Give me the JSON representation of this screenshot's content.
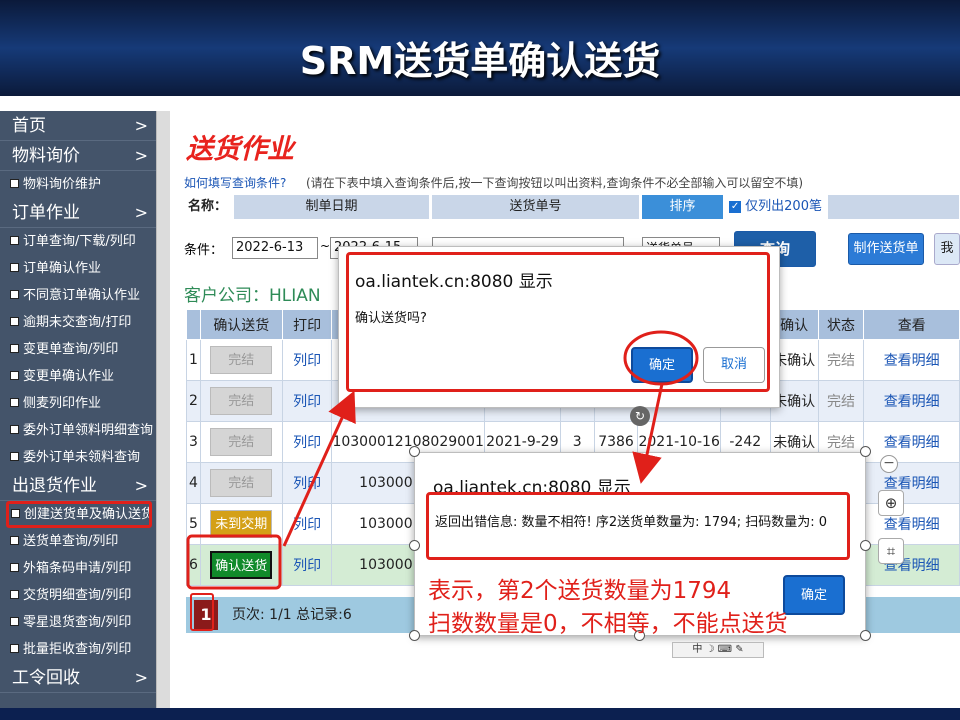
{
  "banner": {
    "title": "SRM送货单确认送货"
  },
  "sidebar": {
    "groups": [
      {
        "label": "首页"
      },
      {
        "label": "物料询价"
      },
      {
        "label": "订单作业"
      },
      {
        "label": "出退货作业"
      },
      {
        "label": "工令回收"
      }
    ],
    "items": [
      "物料询价维护",
      "订单查询/下载/列印",
      "订单确认作业",
      "不同意订单确认作业",
      "逾期未交查询/打印",
      "变更单查询/列印",
      "变更单确认作业",
      "侧麦列印作业",
      "委外订单领料明细查询",
      "委外订单未领料查询",
      "创建送货单及确认送货",
      "送货单查询/列印",
      "外箱条码申请/列印",
      "交货明细查询/列印",
      "零星退货查询/列印",
      "批量拒收查询/列印"
    ]
  },
  "main": {
    "title": "送货作业",
    "hint_link": "如何填写查询条件?",
    "hint_text": "(请在下表中填入查询条件后,按一下查询按钮以叫出资料,查询条件不必全部输入可以留空不填)",
    "query_headers": {
      "name": "名称",
      "date": "制单日期",
      "number": "送货单号",
      "sort": "排序",
      "limit": "仅列出200笔"
    },
    "condition_label": "条件",
    "date_from": "2022-6-13",
    "date_to": "2022-6-15",
    "sort_value": "送货单号",
    "query_button": "查询",
    "create_button": "制作送货单",
    "extra_button": "我",
    "company": "客户公司：HLIAN"
  },
  "grid": {
    "headers": [
      "",
      "确认送货",
      "打印",
      "",
      "",
      "",
      "",
      "",
      "确认",
      "状态",
      "查看"
    ],
    "rows": [
      {
        "no": "1",
        "status_btn": "完结",
        "print": "列印",
        "order": "",
        "date": "",
        "qty": "",
        "num": "",
        "due": "",
        "diff": "",
        "confirm": "未确认",
        "state": "完结",
        "view": "查看明细"
      },
      {
        "no": "2",
        "status_btn": "完结",
        "print": "列印",
        "order": "",
        "date": "",
        "qty": "",
        "num": "",
        "due": "",
        "diff": "",
        "confirm": "未确认",
        "state": "完结",
        "view": "查看明细"
      },
      {
        "no": "3",
        "status_btn": "完结",
        "print": "列印",
        "order": "10300012108029001",
        "date": "2021-9-29",
        "qty": "3",
        "num": "7386",
        "due": "2021-10-16",
        "diff": "-242",
        "confirm": "未确认",
        "state": "完结",
        "view": "查看明细"
      },
      {
        "no": "4",
        "status_btn": "完结",
        "print": "列印",
        "order": "10300012109",
        "date": "",
        "qty": "",
        "num": "",
        "due": "",
        "diff": "",
        "confirm": "",
        "state": "",
        "view": "查看明细"
      },
      {
        "no": "5",
        "status_btn": "未到交期",
        "print": "列印",
        "order": "10300012205",
        "date": "",
        "qty": "",
        "num": "",
        "due": "",
        "diff": "",
        "confirm": "",
        "state": "",
        "view": "查看明细"
      },
      {
        "no": "6",
        "status_btn": "确认送货",
        "print": "列印",
        "order": "10300012205",
        "date": "",
        "qty": "",
        "num": "",
        "due": "",
        "diff": "",
        "confirm": "",
        "state": "",
        "view": "查看明细"
      }
    ]
  },
  "pager": {
    "page_num": "1",
    "text": "页次: 1/1 总记录:6"
  },
  "dialog_confirm": {
    "title": "oa.liantek.cn:8080 显示",
    "message": "确认送货吗?",
    "ok": "确定",
    "cancel": "取消"
  },
  "dialog_error": {
    "title": "oa.liantek.cn:8080 显示",
    "message": "返回出错信息: 数量不相符! 序2送货单数量为: 1794; 扫码数量为: 0",
    "ok": "确定"
  },
  "annotation": {
    "line1": "表示，第2个送货数量为1794",
    "line2": "扫数数量是0，不相等，不能点送货"
  },
  "colors": {
    "accent_red": "#e0201a",
    "banner": "#163a78",
    "sidebar": "#44546a",
    "link": "#1a55b5"
  }
}
